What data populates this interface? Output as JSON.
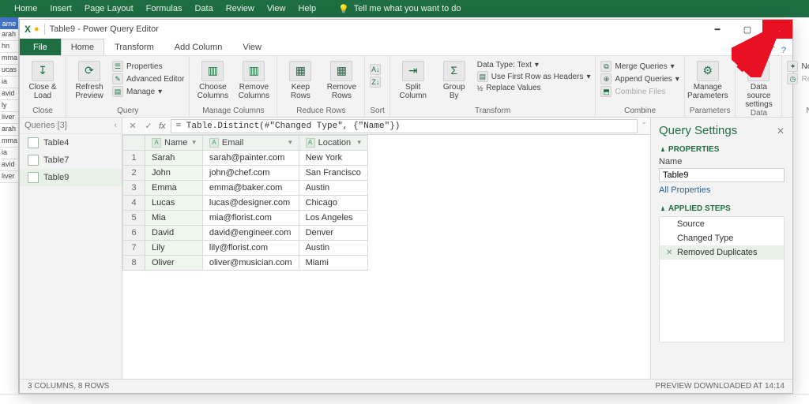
{
  "excel_tabs": [
    "Home",
    "Insert",
    "Page Layout",
    "Formulas",
    "Data",
    "Review",
    "View",
    "Help"
  ],
  "tell_me": "Tell me what you want to do",
  "excel_col_header": "ame",
  "excel_cells": [
    "arah",
    "hn",
    "mma",
    "ucas",
    "ia",
    "avid",
    "ly",
    "liver",
    "arah",
    "mma",
    "ia",
    "avid",
    "liver"
  ],
  "window_title": "Table9 - Power Query Editor",
  "ribbon_tabs": {
    "file": "File",
    "home": "Home",
    "transform": "Transform",
    "add": "Add Column",
    "view": "View"
  },
  "ribbon": {
    "close_load": "Close &\nLoad",
    "close_group": "Close",
    "refresh": "Refresh\nPreview",
    "properties": "Properties",
    "adv_editor": "Advanced Editor",
    "manage": "Manage",
    "query_group": "Query",
    "choose_cols": "Choose\nColumns",
    "remove_cols": "Remove\nColumns",
    "manage_cols_group": "Manage Columns",
    "keep_rows": "Keep\nRows",
    "remove_rows": "Remove\nRows",
    "reduce_group": "Reduce Rows",
    "sort_group": "Sort",
    "split_col": "Split\nColumn",
    "group_by": "Group\nBy",
    "datatype": "Data Type: Text",
    "first_row": "Use First Row as Headers",
    "replace": "Replace Values",
    "transform_group": "Transform",
    "merge": "Merge Queries",
    "append": "Append Queries",
    "combine_files": "Combine Files",
    "combine_group": "Combine",
    "manage_params": "Manage\nParameters",
    "params_group": "Parameters",
    "ds_settings": "Data source\nsettings",
    "ds_group": "Data Sources",
    "new_source": "New Source",
    "recent": "Recent Sources",
    "newq_group": "New Query"
  },
  "queries": {
    "header": "Queries [3]",
    "items": [
      "Table4",
      "Table7",
      "Table9"
    ],
    "active": 2
  },
  "formula": "= Table.Distinct(#\"Changed Type\", {\"Name\"})",
  "columns": [
    "Name",
    "Email",
    "Location"
  ],
  "rows": [
    {
      "n": "1",
      "name": "Sarah",
      "email": "sarah@painter.com",
      "loc": "New York"
    },
    {
      "n": "2",
      "name": "John",
      "email": "john@chef.com",
      "loc": "San Francisco"
    },
    {
      "n": "3",
      "name": "Emma",
      "email": "emma@baker.com",
      "loc": "Austin"
    },
    {
      "n": "4",
      "name": "Lucas",
      "email": "lucas@designer.com",
      "loc": "Chicago"
    },
    {
      "n": "5",
      "name": "Mia",
      "email": "mia@florist.com",
      "loc": "Los Angeles"
    },
    {
      "n": "6",
      "name": "David",
      "email": "david@engineer.com",
      "loc": "Denver"
    },
    {
      "n": "7",
      "name": "Lily",
      "email": "lily@florist.com",
      "loc": "Austin"
    },
    {
      "n": "8",
      "name": "Oliver",
      "email": "oliver@musician.com",
      "loc": "Miami"
    }
  ],
  "settings": {
    "title": "Query Settings",
    "properties": "PROPERTIES",
    "name_label": "Name",
    "name_value": "Table9",
    "all_props": "All Properties",
    "applied": "APPLIED STEPS",
    "steps": [
      "Source",
      "Changed Type",
      "Removed Duplicates"
    ],
    "active_step": 2
  },
  "status_left": "3 COLUMNS, 8 ROWS",
  "status_right": "PREVIEW DOWNLOADED AT 14:14"
}
